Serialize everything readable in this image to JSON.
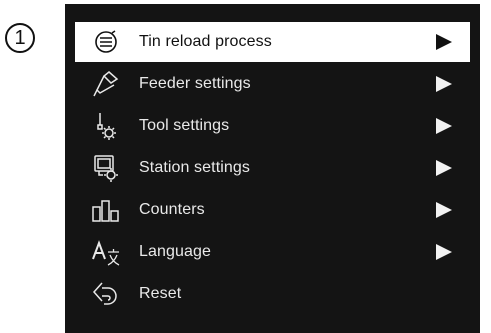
{
  "callout_number": "1",
  "menu": {
    "items": [
      {
        "label": "Tin reload process",
        "icon": "tin-reload-icon",
        "selected": true,
        "has_submenu": true
      },
      {
        "label": "Feeder settings",
        "icon": "feeder-icon",
        "selected": false,
        "has_submenu": true
      },
      {
        "label": "Tool settings",
        "icon": "tool-settings-icon",
        "selected": false,
        "has_submenu": true
      },
      {
        "label": "Station settings",
        "icon": "station-settings-icon",
        "selected": false,
        "has_submenu": true
      },
      {
        "label": "Counters",
        "icon": "counters-icon",
        "selected": false,
        "has_submenu": true
      },
      {
        "label": "Language",
        "icon": "language-icon",
        "selected": false,
        "has_submenu": true
      },
      {
        "label": "Reset",
        "icon": "reset-icon",
        "selected": false,
        "has_submenu": false
      }
    ]
  },
  "colors": {
    "panel_bg": "#141414",
    "selected_bg": "#ffffff",
    "text": "#e9e9e9"
  }
}
